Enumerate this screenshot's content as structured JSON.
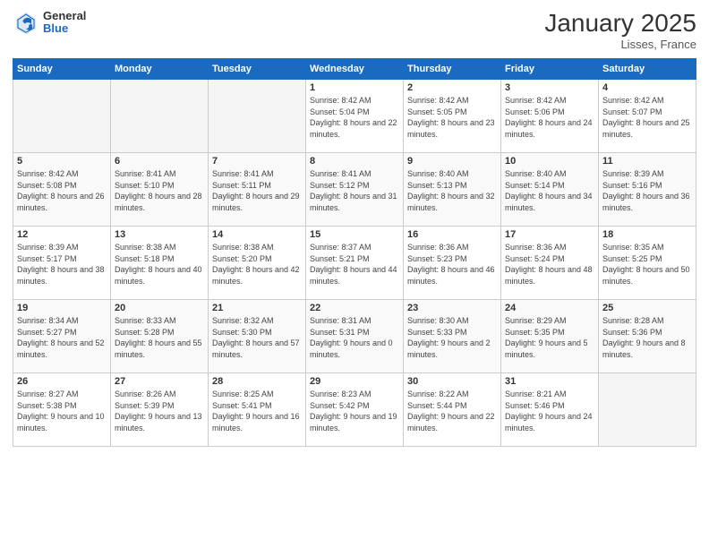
{
  "logo": {
    "general": "General",
    "blue": "Blue"
  },
  "title": "January 2025",
  "location": "Lisses, France",
  "days_header": [
    "Sunday",
    "Monday",
    "Tuesday",
    "Wednesday",
    "Thursday",
    "Friday",
    "Saturday"
  ],
  "weeks": [
    [
      {
        "day": "",
        "info": ""
      },
      {
        "day": "",
        "info": ""
      },
      {
        "day": "",
        "info": ""
      },
      {
        "day": "1",
        "info": "Sunrise: 8:42 AM\nSunset: 5:04 PM\nDaylight: 8 hours and 22 minutes."
      },
      {
        "day": "2",
        "info": "Sunrise: 8:42 AM\nSunset: 5:05 PM\nDaylight: 8 hours and 23 minutes."
      },
      {
        "day": "3",
        "info": "Sunrise: 8:42 AM\nSunset: 5:06 PM\nDaylight: 8 hours and 24 minutes."
      },
      {
        "day": "4",
        "info": "Sunrise: 8:42 AM\nSunset: 5:07 PM\nDaylight: 8 hours and 25 minutes."
      }
    ],
    [
      {
        "day": "5",
        "info": "Sunrise: 8:42 AM\nSunset: 5:08 PM\nDaylight: 8 hours and 26 minutes."
      },
      {
        "day": "6",
        "info": "Sunrise: 8:41 AM\nSunset: 5:10 PM\nDaylight: 8 hours and 28 minutes."
      },
      {
        "day": "7",
        "info": "Sunrise: 8:41 AM\nSunset: 5:11 PM\nDaylight: 8 hours and 29 minutes."
      },
      {
        "day": "8",
        "info": "Sunrise: 8:41 AM\nSunset: 5:12 PM\nDaylight: 8 hours and 31 minutes."
      },
      {
        "day": "9",
        "info": "Sunrise: 8:40 AM\nSunset: 5:13 PM\nDaylight: 8 hours and 32 minutes."
      },
      {
        "day": "10",
        "info": "Sunrise: 8:40 AM\nSunset: 5:14 PM\nDaylight: 8 hours and 34 minutes."
      },
      {
        "day": "11",
        "info": "Sunrise: 8:39 AM\nSunset: 5:16 PM\nDaylight: 8 hours and 36 minutes."
      }
    ],
    [
      {
        "day": "12",
        "info": "Sunrise: 8:39 AM\nSunset: 5:17 PM\nDaylight: 8 hours and 38 minutes."
      },
      {
        "day": "13",
        "info": "Sunrise: 8:38 AM\nSunset: 5:18 PM\nDaylight: 8 hours and 40 minutes."
      },
      {
        "day": "14",
        "info": "Sunrise: 8:38 AM\nSunset: 5:20 PM\nDaylight: 8 hours and 42 minutes."
      },
      {
        "day": "15",
        "info": "Sunrise: 8:37 AM\nSunset: 5:21 PM\nDaylight: 8 hours and 44 minutes."
      },
      {
        "day": "16",
        "info": "Sunrise: 8:36 AM\nSunset: 5:23 PM\nDaylight: 8 hours and 46 minutes."
      },
      {
        "day": "17",
        "info": "Sunrise: 8:36 AM\nSunset: 5:24 PM\nDaylight: 8 hours and 48 minutes."
      },
      {
        "day": "18",
        "info": "Sunrise: 8:35 AM\nSunset: 5:25 PM\nDaylight: 8 hours and 50 minutes."
      }
    ],
    [
      {
        "day": "19",
        "info": "Sunrise: 8:34 AM\nSunset: 5:27 PM\nDaylight: 8 hours and 52 minutes."
      },
      {
        "day": "20",
        "info": "Sunrise: 8:33 AM\nSunset: 5:28 PM\nDaylight: 8 hours and 55 minutes."
      },
      {
        "day": "21",
        "info": "Sunrise: 8:32 AM\nSunset: 5:30 PM\nDaylight: 8 hours and 57 minutes."
      },
      {
        "day": "22",
        "info": "Sunrise: 8:31 AM\nSunset: 5:31 PM\nDaylight: 9 hours and 0 minutes."
      },
      {
        "day": "23",
        "info": "Sunrise: 8:30 AM\nSunset: 5:33 PM\nDaylight: 9 hours and 2 minutes."
      },
      {
        "day": "24",
        "info": "Sunrise: 8:29 AM\nSunset: 5:35 PM\nDaylight: 9 hours and 5 minutes."
      },
      {
        "day": "25",
        "info": "Sunrise: 8:28 AM\nSunset: 5:36 PM\nDaylight: 9 hours and 8 minutes."
      }
    ],
    [
      {
        "day": "26",
        "info": "Sunrise: 8:27 AM\nSunset: 5:38 PM\nDaylight: 9 hours and 10 minutes."
      },
      {
        "day": "27",
        "info": "Sunrise: 8:26 AM\nSunset: 5:39 PM\nDaylight: 9 hours and 13 minutes."
      },
      {
        "day": "28",
        "info": "Sunrise: 8:25 AM\nSunset: 5:41 PM\nDaylight: 9 hours and 16 minutes."
      },
      {
        "day": "29",
        "info": "Sunrise: 8:23 AM\nSunset: 5:42 PM\nDaylight: 9 hours and 19 minutes."
      },
      {
        "day": "30",
        "info": "Sunrise: 8:22 AM\nSunset: 5:44 PM\nDaylight: 9 hours and 22 minutes."
      },
      {
        "day": "31",
        "info": "Sunrise: 8:21 AM\nSunset: 5:46 PM\nDaylight: 9 hours and 24 minutes."
      },
      {
        "day": "",
        "info": ""
      }
    ]
  ]
}
